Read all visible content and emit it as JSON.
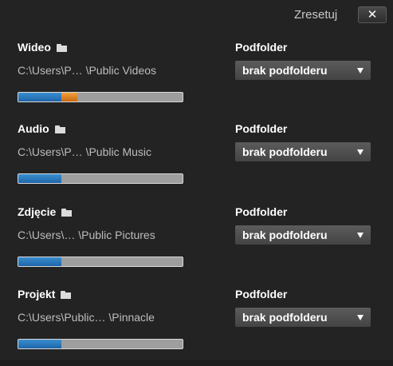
{
  "header": {
    "reset_label": "Zresetuj",
    "close_label": "✕"
  },
  "sections": [
    {
      "label": "Wideo",
      "path": "C:\\Users\\P… \\Public Videos",
      "subfolder_label": "Podfolder",
      "subfolder_value": "brak podfolderu",
      "usage_primary_percent": 26,
      "usage_secondary_percent": 10
    },
    {
      "label": "Audio",
      "path": "C:\\Users\\P… \\Public Music",
      "subfolder_label": "Podfolder",
      "subfolder_value": "brak podfolderu",
      "usage_primary_percent": 26,
      "usage_secondary_percent": 0
    },
    {
      "label": "Zdjęcie",
      "path": "C:\\Users\\… \\Public Pictures",
      "subfolder_label": "Podfolder",
      "subfolder_value": "brak podfolderu",
      "usage_primary_percent": 26,
      "usage_secondary_percent": 0
    },
    {
      "label": "Projekt",
      "path": "C:\\Users\\Public… \\Pinnacle",
      "subfolder_label": "Podfolder",
      "subfolder_value": "brak podfolderu",
      "usage_primary_percent": 26,
      "usage_secondary_percent": 0
    }
  ],
  "colors": {
    "background": "#232323",
    "bar_primary": "#2a7abf",
    "bar_secondary": "#e0891e",
    "bar_track": "#9e9e9e",
    "dropdown_bg": "#505050"
  },
  "icons": {
    "folder": "folder-icon",
    "close": "close-icon",
    "dropdown": "chevron-down-icon"
  }
}
